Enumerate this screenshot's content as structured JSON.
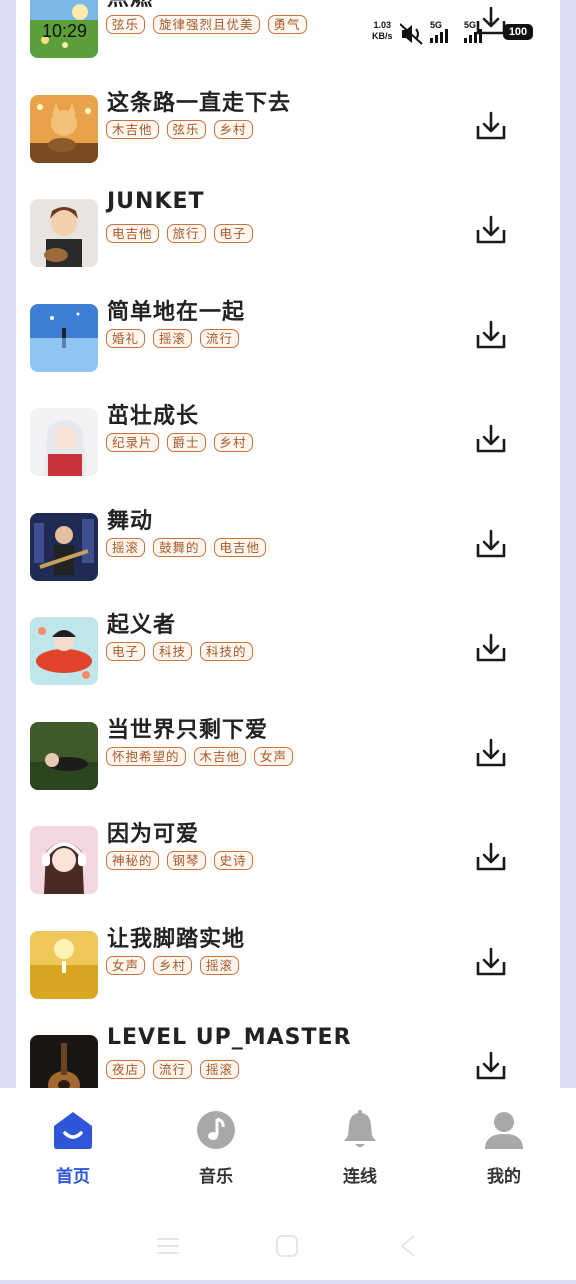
{
  "status_bar": {
    "time": "10:29",
    "net_speed_value": "1.03",
    "net_speed_unit": "KB/s",
    "battery": "100",
    "icons": [
      "mute-icon",
      "signal-5g-icon",
      "signal-5g-icon",
      "battery-icon"
    ]
  },
  "songs": [
    {
      "title": "点燃",
      "tags": [
        "弦乐",
        "旋律强烈且优美",
        "勇气"
      ],
      "thumb": "meadow-sunset"
    },
    {
      "title": "这条路一直走下去",
      "tags": [
        "木吉他",
        "弦乐",
        "乡村"
      ],
      "thumb": "fox-guitar"
    },
    {
      "title": "JUNKET",
      "tags": [
        "电吉他",
        "旅行",
        "电子"
      ],
      "thumb": "boy-guitar"
    },
    {
      "title": "简单地在一起",
      "tags": [
        "婚礼",
        "摇滚",
        "流行"
      ],
      "thumb": "sky-reflection"
    },
    {
      "title": "茁壮成长",
      "tags": [
        "纪录片",
        "爵士",
        "乡村"
      ],
      "thumb": "white-hair-girl"
    },
    {
      "title": "舞动",
      "tags": [
        "摇滚",
        "鼓舞的",
        "电吉他"
      ],
      "thumb": "city-guitarist"
    },
    {
      "title": "起义者",
      "tags": [
        "电子",
        "科技",
        "科技的"
      ],
      "thumb": "koi-girl"
    },
    {
      "title": "当世界只剩下爱",
      "tags": [
        "怀抱希望的",
        "木吉他",
        "女声"
      ],
      "thumb": "grass-girl"
    },
    {
      "title": "因为可爱",
      "tags": [
        "神秘的",
        "钢琴",
        "史诗"
      ],
      "thumb": "headphone-girl"
    },
    {
      "title": "让我脚踏实地",
      "tags": [
        "女声",
        "乡村",
        "摇滚"
      ],
      "thumb": "flower-field"
    },
    {
      "title": "LEVEL UP_MASTER",
      "tags": [
        "夜店",
        "流行",
        "摇滚"
      ],
      "thumb": "dark-guitar"
    }
  ],
  "nav": {
    "items": [
      {
        "label": "首页",
        "icon": "home-icon",
        "active": true
      },
      {
        "label": "音乐",
        "icon": "music-note-icon",
        "active": false
      },
      {
        "label": "连线",
        "icon": "bell-icon",
        "active": false
      },
      {
        "label": "我的",
        "icon": "user-icon",
        "active": false
      }
    ]
  },
  "colors": {
    "accent": "#2f56d9",
    "tag_text": "#a6582a",
    "tag_border": "#c9743d",
    "nav_inactive": "#a8a8a8",
    "side_bg": "#ddddf7"
  }
}
